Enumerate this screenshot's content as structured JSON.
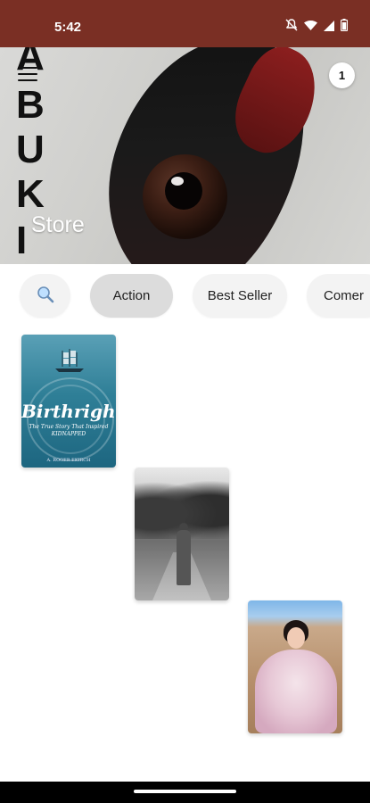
{
  "status": {
    "time": "5:42",
    "icons": [
      "notifications-off-icon",
      "wifi-icon",
      "signal-icon",
      "battery-icon"
    ]
  },
  "hero": {
    "title": "Store",
    "vertical_letters": [
      "A",
      "B",
      "U",
      "K",
      "I"
    ],
    "cart_count": "1"
  },
  "chips": {
    "search_icon": "search-icon",
    "items": [
      "Action",
      "Best Seller",
      "Comer"
    ],
    "active": "Action"
  },
  "books": [
    {
      "title": "Birthright",
      "subtitle": "The True Story That Inspired KIDNAPPED",
      "author": "A. ROGER EKIRCH"
    },
    {},
    {}
  ],
  "colors": {
    "status_bar": "#7a2f24",
    "chip_bg": "#f3f3f3",
    "chip_active_bg": "#dcdcdc"
  }
}
